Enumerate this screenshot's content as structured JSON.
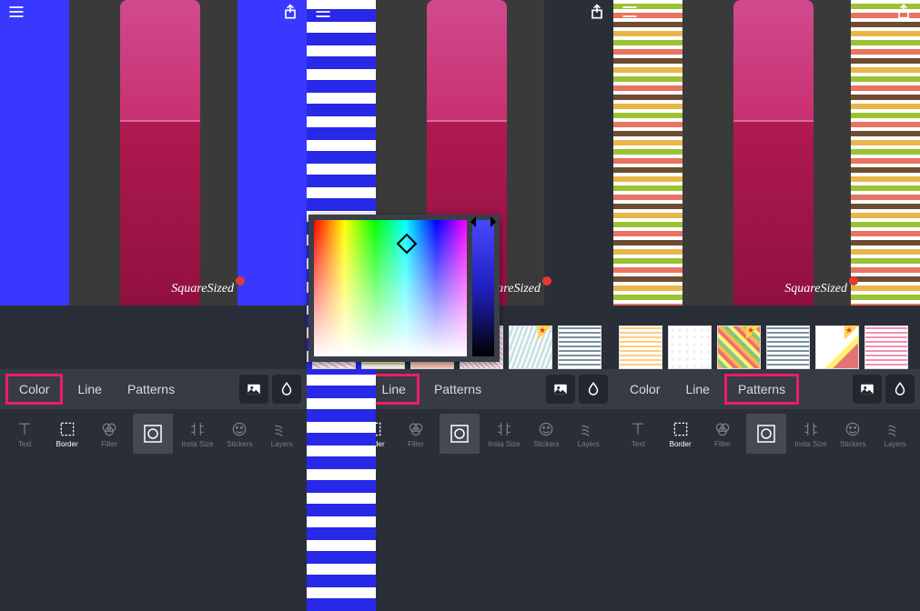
{
  "watermark": "SquareSized",
  "tabs": {
    "color": "Color",
    "line": "Line",
    "patterns": "Patterns"
  },
  "tools": {
    "text": "Text",
    "border": "Border",
    "filter": "Filter",
    "instasize": "Insta Size",
    "stickers": "Stickers",
    "layers": "Layers"
  },
  "screens": [
    {
      "border": "solid",
      "highlight": "color",
      "picker": false,
      "patterns": false
    },
    {
      "border": "dash",
      "highlight": "line",
      "picker": true,
      "patterns": true
    },
    {
      "border": "stripes",
      "highlight": "patterns",
      "picker": false,
      "patterns": true
    }
  ]
}
